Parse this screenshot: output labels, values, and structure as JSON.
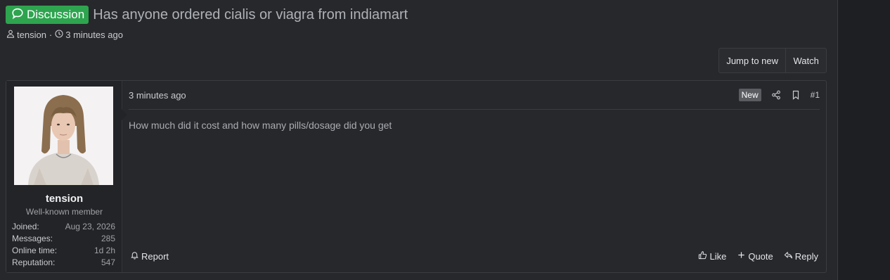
{
  "thread": {
    "label": "Discussion",
    "title": "Has anyone ordered cialis or viagra from indiamart",
    "author": "tension",
    "time": "3 minutes ago"
  },
  "buttons": {
    "jump_to_new": "Jump to new",
    "watch": "Watch"
  },
  "post": {
    "date": "3 minutes ago",
    "new_badge": "New",
    "number": "#1",
    "body": "How much did it cost and how many pills/dosage did you get",
    "actions": {
      "report": "Report",
      "like": "Like",
      "quote": "Quote",
      "reply": "Reply"
    }
  },
  "user": {
    "name": "tension",
    "title": "Well-known member",
    "stats": [
      {
        "label": "Joined:",
        "value": "Aug 23, 2026"
      },
      {
        "label": "Messages:",
        "value": "285"
      },
      {
        "label": "Online time:",
        "value": "1d 2h"
      },
      {
        "label": "Reputation:",
        "value": "547"
      }
    ]
  },
  "icons": {
    "discussion": "speech-bubble-icon",
    "author": "user-icon",
    "time": "clock-icon",
    "share": "share-icon",
    "bookmark": "bookmark-icon",
    "report": "bell-icon",
    "like": "thumbs-up-icon",
    "quote": "plus-icon",
    "reply": "reply-icon"
  },
  "colors": {
    "label_green": "#2ea44f",
    "background": "#27282c",
    "new_badge": "#5a5c61"
  }
}
